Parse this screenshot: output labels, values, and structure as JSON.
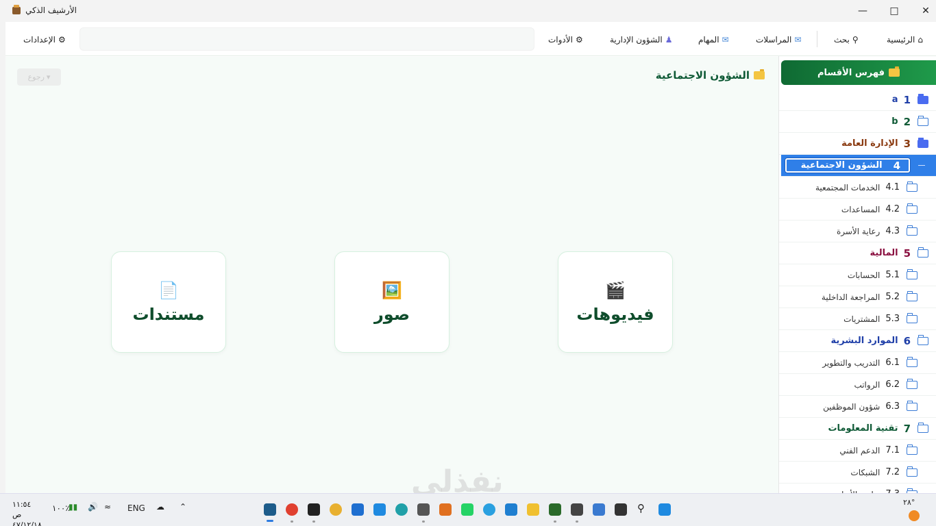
{
  "window": {
    "title": "الأرشيف الذكي"
  },
  "nav": {
    "home": "الرئيسية",
    "search": "بحث",
    "correspondence": "المراسلات",
    "tasks": "المهام",
    "admin_affairs": "الشؤون الإدارية",
    "tools": "الأدوات",
    "settings": "الإعدادات",
    "search_placeholder": ""
  },
  "sidebar": {
    "header": "فهرس الأقسام",
    "items": [
      {
        "num": "1",
        "label": "a",
        "level": 0,
        "color": "#1f3fa8",
        "filled": true
      },
      {
        "num": "2",
        "label": "b",
        "level": 0,
        "color": "#0f5a36",
        "filled": false
      },
      {
        "num": "3",
        "label": "الإدارة العامة",
        "level": 0,
        "color": "#8a3a10",
        "filled": true
      },
      {
        "num": "4",
        "label": "الشؤون الاجتماعية",
        "level": 0,
        "color": "#ffffff",
        "active": true
      },
      {
        "num": "4.1",
        "label": "الخدمات المجتمعية",
        "level": 1
      },
      {
        "num": "4.2",
        "label": "المساعدات",
        "level": 1
      },
      {
        "num": "4.3",
        "label": "رعاية الأسرة",
        "level": 1
      },
      {
        "num": "5",
        "label": "المالية",
        "level": 0,
        "color": "#8a1040"
      },
      {
        "num": "5.1",
        "label": "الحسابات",
        "level": 1
      },
      {
        "num": "5.2",
        "label": "المراجعة الداخلية",
        "level": 1
      },
      {
        "num": "5.3",
        "label": "المشتريات",
        "level": 1
      },
      {
        "num": "6",
        "label": "الموارد البشرية",
        "level": 0,
        "color": "#1f3fa8"
      },
      {
        "num": "6.1",
        "label": "التدريب والتطوير",
        "level": 1
      },
      {
        "num": "6.2",
        "label": "الرواتب",
        "level": 1
      },
      {
        "num": "6.3",
        "label": "شؤون الموظفين",
        "level": 1
      },
      {
        "num": "7",
        "label": "تقنية المعلومات",
        "level": 0,
        "color": "#0f5a36"
      },
      {
        "num": "7.1",
        "label": "الدعم الفني",
        "level": 1
      },
      {
        "num": "7.2",
        "label": "الشبكات",
        "level": 1
      },
      {
        "num": "7.3",
        "label": "تطوير الأنظمة",
        "level": 1
      }
    ]
  },
  "main": {
    "back_label": "رجوع",
    "title": "الشؤون الاجتماعية",
    "cards": [
      {
        "label": "فيديوهات",
        "icon": "🎬"
      },
      {
        "label": "صور",
        "icon": "🖼️"
      },
      {
        "label": "مستندات",
        "icon": "📄"
      }
    ]
  },
  "watermark": "نفذلي",
  "taskbar": {
    "time": "١١:٥٤ ص",
    "date": "٤٧/١٢/١٨",
    "battery": "١٠٠٪",
    "lang": "ENG",
    "temp": "٢٨°"
  },
  "colors": {
    "accent": "#1f9a4a",
    "active_row": "#2f7fe8",
    "title": "#0f5a36"
  }
}
